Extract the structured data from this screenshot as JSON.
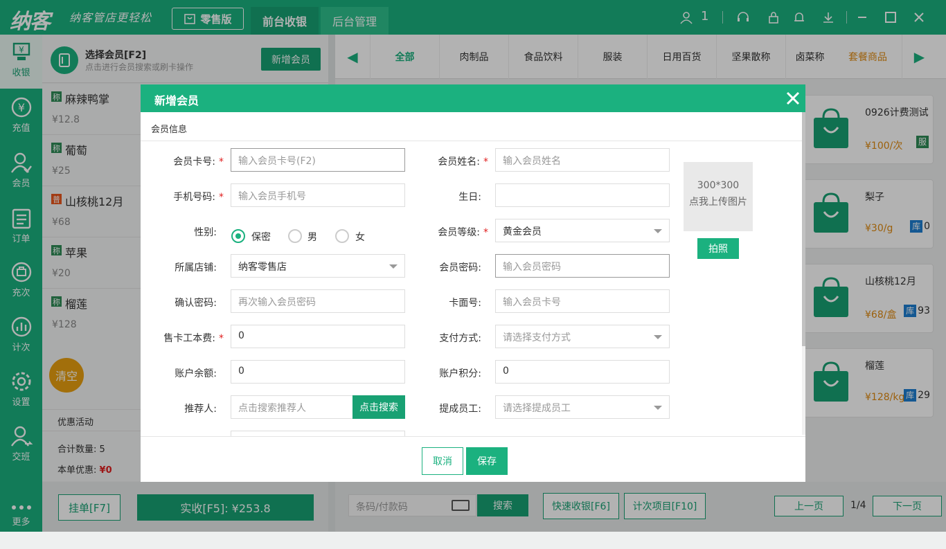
{
  "app": {
    "logo": "纳客",
    "slogan": "纳客管店更轻松",
    "retail_label": "零售版",
    "tabs": [
      "前台收银",
      "后台管理"
    ],
    "user_count": "1",
    "brand_color": "#1bb17f"
  },
  "nav": {
    "items": [
      {
        "label": "收银",
        "icon": "cashier-icon"
      },
      {
        "label": "充值",
        "icon": "recharge-icon"
      },
      {
        "label": "会员",
        "icon": "member-icon"
      },
      {
        "label": "订单",
        "icon": "order-icon"
      },
      {
        "label": "充次",
        "icon": "recharge-times-icon"
      },
      {
        "label": "计次",
        "icon": "count-icon"
      },
      {
        "label": "设置",
        "icon": "settings-icon"
      },
      {
        "label": "交班",
        "icon": "shift-icon"
      },
      {
        "label": "更多",
        "icon": "more-icon"
      }
    ]
  },
  "member": {
    "title": "选择会员[F2]",
    "subtitle": "点击进行会员搜索或刷卡操作",
    "new_button": "新增会员"
  },
  "cart": {
    "items": [
      {
        "badge": "称",
        "name": "麻辣鸭掌",
        "price": "¥12.8"
      },
      {
        "badge": "称",
        "name": "葡萄",
        "price": "¥25"
      },
      {
        "badge": "普",
        "name": "山核桃12月",
        "price": "¥68"
      },
      {
        "badge": "称",
        "name": "苹果",
        "price": "¥20"
      },
      {
        "badge": "称",
        "name": "榴莲",
        "price": "¥128"
      }
    ],
    "clear_label": "清空",
    "promo_label": "优惠活动",
    "total_qty_label": "合计数量:",
    "total_qty": "5",
    "discount_label": "本单优惠:",
    "discount": "¥0",
    "hold_label": "挂单[F7]",
    "pay_label": "实收[F5]: ¥253.8"
  },
  "categories": [
    "全部",
    "肉制品",
    "食品饮料",
    "服装",
    "日用百货",
    "坚果散称",
    "卤菜称",
    "套餐商品"
  ],
  "products": [
    {
      "name": "0926计费测试",
      "price": "¥100/次",
      "stock_badge": "服",
      "stock": ""
    },
    {
      "name": "梨子",
      "price": "¥30/g",
      "stock_badge": "库",
      "stock": "0"
    },
    {
      "name": "山核桃12月",
      "price": "¥68/盒",
      "stock_badge": "库",
      "stock": "93"
    },
    {
      "name": "榴莲",
      "price": "¥128/kg",
      "stock_badge": "库",
      "stock": "29"
    }
  ],
  "bottom": {
    "barcode_placeholder": "条码/付款码",
    "search_label": "搜索",
    "quick_label": "快速收银[F6]",
    "count_label": "计次项目[F10]",
    "prev_label": "上一页",
    "page": "1/4",
    "next_label": "下一页"
  },
  "modal": {
    "title": "新增会员",
    "section": "会员信息",
    "fields": {
      "card_no": {
        "label": "会员卡号:",
        "placeholder": "输入会员卡号(F2)"
      },
      "name": {
        "label": "会员姓名:",
        "placeholder": "输入会员姓名"
      },
      "phone": {
        "label": "手机号码:",
        "placeholder": "输入会员手机号"
      },
      "birthday": {
        "label": "生日:",
        "value": ""
      },
      "gender": {
        "label": "性别:",
        "options": [
          "保密",
          "男",
          "女"
        ],
        "selected": "保密"
      },
      "level": {
        "label": "会员等级:",
        "value": "黄金会员"
      },
      "store": {
        "label": "所属店铺:",
        "value": "纳客零售店"
      },
      "password": {
        "label": "会员密码:",
        "placeholder": "输入会员密码"
      },
      "confirm": {
        "label": "确认密码:",
        "placeholder": "再次输入会员密码"
      },
      "face_no": {
        "label": "卡面号:",
        "placeholder": "输入会员卡号"
      },
      "card_fee": {
        "label": "售卡工本费:",
        "value": "0"
      },
      "pay_method": {
        "label": "支付方式:",
        "placeholder": "请选择支付方式"
      },
      "balance": {
        "label": "账户余额:",
        "value": "0"
      },
      "points": {
        "label": "账户积分:",
        "value": "0"
      },
      "referrer": {
        "label": "推荐人:",
        "placeholder": "点击搜索推荐人",
        "button": "点击搜索"
      },
      "staff": {
        "label": "提成员工:",
        "placeholder": "请选择提成员工"
      }
    },
    "photo_size": "300*300",
    "photo_hint": "点我上传图片",
    "photo_button": "拍照",
    "cancel": "取消",
    "save": "保存"
  }
}
